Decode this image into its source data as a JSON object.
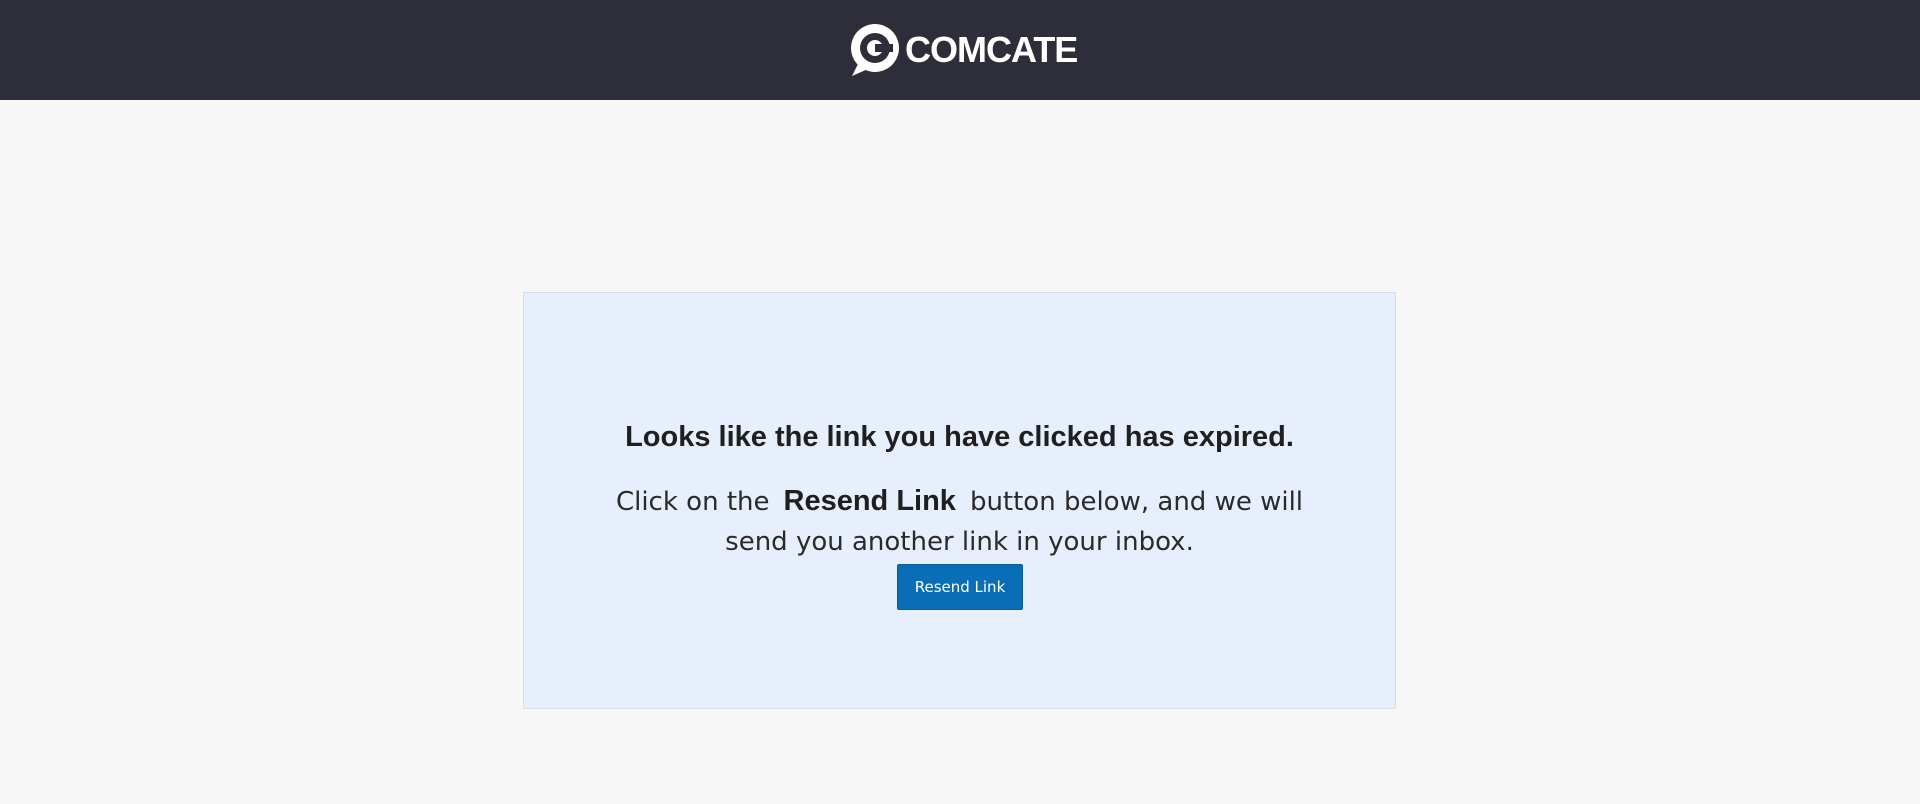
{
  "header": {
    "brand": "COMCATE",
    "logo_icon": "comcate-speech-c-icon",
    "background_color": "#2e2d3a"
  },
  "card": {
    "headline": "Looks like the link you have clicked has expired.",
    "message_prefix": "Click on the",
    "message_emphasis": "Resend Link",
    "message_suffix_line1": "button below, and we will",
    "message_line2": "send you another link in your inbox.",
    "background_color": "#e7effc"
  },
  "actions": {
    "resend_label": "Resend Link",
    "button_color": "#0a6eb7"
  }
}
